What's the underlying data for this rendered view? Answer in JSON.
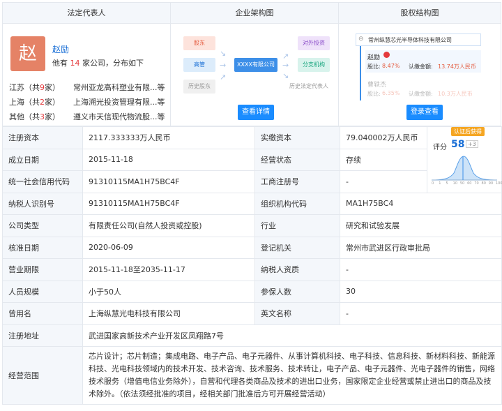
{
  "headers": {
    "legal_rep": "法定代表人",
    "org_chart": "企业架构图",
    "equity_chart": "股权结构图"
  },
  "legal_rep": {
    "avatar_char": "赵",
    "name": "赵励",
    "summary_prefix": "他有",
    "company_count": "14",
    "summary_suffix": "家公司，分布如下",
    "regions": [
      {
        "region": "江苏（共",
        "count": "9",
        "unit": "家）",
        "company": "常州亚龙高科塑业有限...等"
      },
      {
        "region": "上海（共",
        "count": "2",
        "unit": "家）",
        "company": "上海溯光投资管理有限...等"
      },
      {
        "region": "其他（共",
        "count": "3",
        "unit": "家）",
        "company": "遵义市天信现代物流股...等"
      }
    ]
  },
  "org_chart": {
    "shareholder": "股东",
    "executive": "高管",
    "history_shareholder": "历史股东",
    "company": "XXXX有限公司",
    "investment": "对外投资",
    "branch": "分支机构",
    "history_rep": "历史法定代表人",
    "button": "查看详情"
  },
  "equity_chart": {
    "company": "常州纵慧芯光半导体科技有限公司",
    "holder1_name": "赵励",
    "holder1_ratio_label": "股比:",
    "holder1_ratio": "8.47%",
    "holder1_amount_label": "认缴金额:",
    "holder1_amount": "13.74万人民币",
    "holder2_name": "曹轶杰",
    "holder2_ratio_label": "股比:",
    "holder2_ratio": "6.35%",
    "holder2_amount_label": "认缴金额:",
    "holder2_amount": "10.3万人民币",
    "button": "登录查看"
  },
  "score": {
    "badge": "认证后获得",
    "label": "评分",
    "value": "58",
    "plus": "+3",
    "axis": [
      "0",
      "1",
      "5",
      "10",
      "50",
      "60",
      "70",
      "80",
      "90",
      "100"
    ]
  },
  "rows": [
    {
      "l1": "注册资本",
      "v1": "2117.333333万人民币",
      "l2": "实缴资本",
      "v2": "79.040002万人民币"
    },
    {
      "l1": "成立日期",
      "v1": "2015-11-18",
      "l2": "经营状态",
      "v2": "存续"
    },
    {
      "l1": "统一社会信用代码",
      "v1": "91310115MA1H75BC4F",
      "l2": "工商注册号",
      "v2": "-"
    },
    {
      "l1": "纳税人识别号",
      "v1": "91310115MA1H75BC4F",
      "l2": "组织机构代码",
      "v2": "MA1H75BC4"
    },
    {
      "l1": "公司类型",
      "v1": "有限责任公司(自然人投资或控股)",
      "l2": "行业",
      "v2": "研究和试验发展"
    },
    {
      "l1": "核准日期",
      "v1": "2020-06-09",
      "l2": "登记机关",
      "v2": "常州市武进区行政审批局"
    },
    {
      "l1": "营业期限",
      "v1": "2015-11-18至2035-11-17",
      "l2": "纳税人资质",
      "v2": "-"
    },
    {
      "l1": "人员规模",
      "v1": "小于50人",
      "l2": "参保人数",
      "v2": "30"
    },
    {
      "l1": "曾用名",
      "v1": "上海纵慧光电科技有限公司",
      "l2": "英文名称",
      "v2": "-"
    }
  ],
  "address": {
    "label": "注册地址",
    "value": "武进国家高新技术产业开发区凤翔路7号"
  },
  "scope": {
    "label": "经营范围",
    "value": "芯片设计；芯片制造；集成电路、电子产品、电子元器件、从事计算机科技、电子科技、信息科技、新材料科技、新能源科技、光电科技领域内的技术开发、技术咨询、技术服务、技术转让，电子产品、电子元器件、光电子器件的销售，网络技术服务（增值电信业务除外），自营和代理各类商品及技术的进出口业务，国家限定企业经营或禁止进出口的商品及技术除外。（依法须经批准的项目，经相关部门批准后方可开展经营活动）"
  }
}
